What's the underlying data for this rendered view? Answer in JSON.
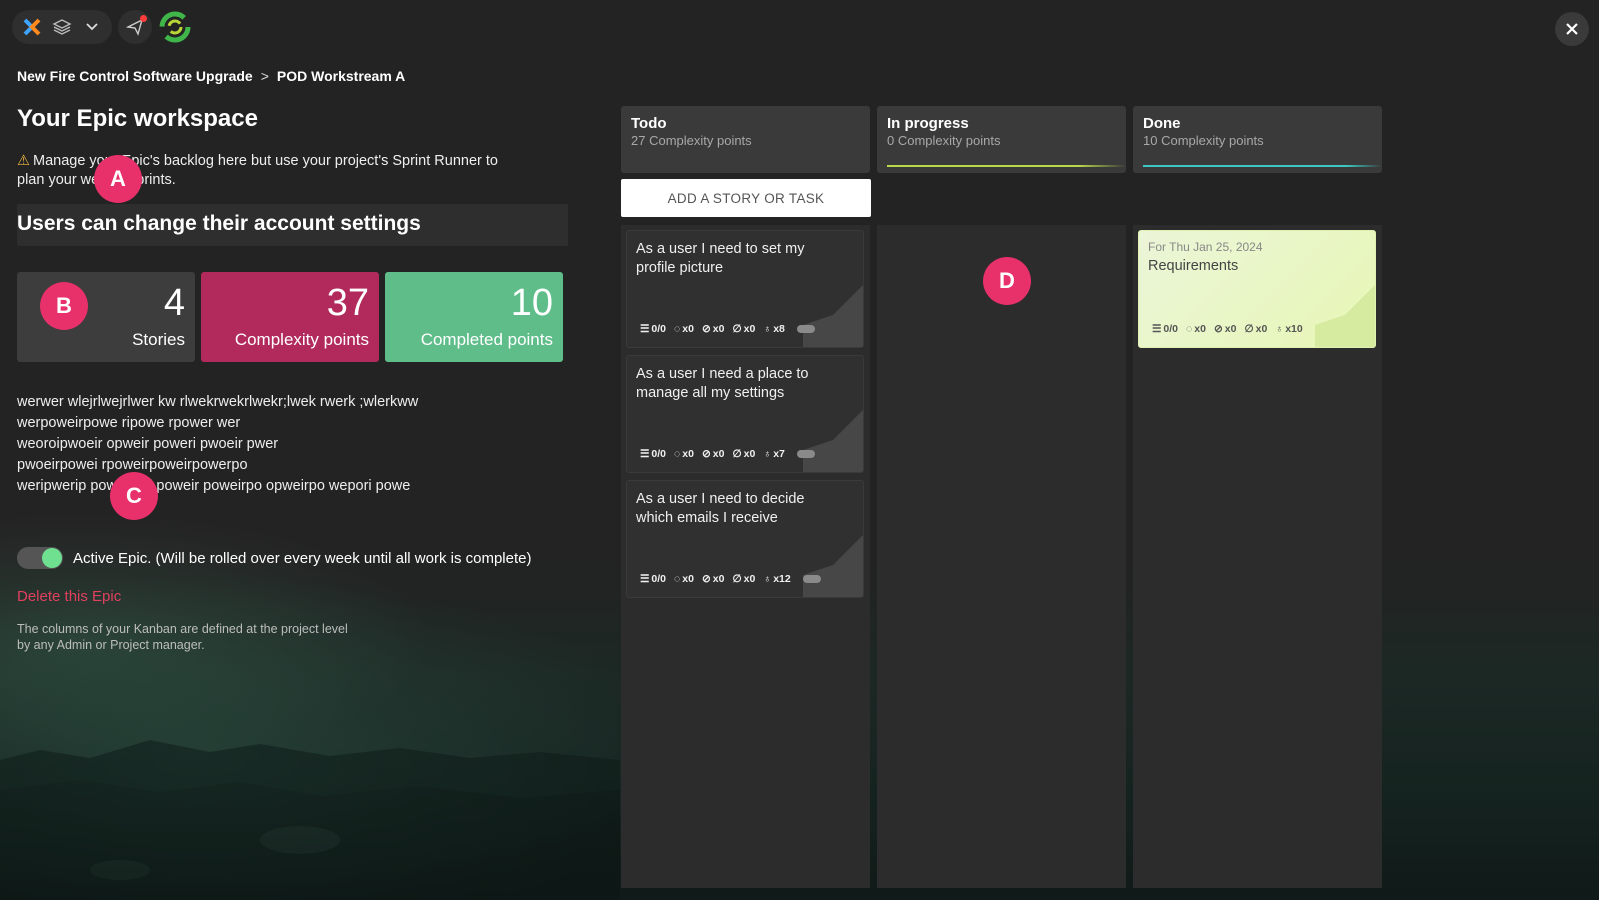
{
  "toolbar": {
    "icons": [
      "app-logo-icon",
      "layers-icon",
      "chevron-down-icon",
      "send-icon",
      "spinner-logo-icon"
    ],
    "close_icon": "close-icon"
  },
  "breadcrumb": {
    "project": "New Fire Control Software Upgrade",
    "separator": ">",
    "workstream": "POD Workstream A"
  },
  "workspace": {
    "title": "Your Epic workspace",
    "warning_icon": "⚠",
    "warning": "Manage your Epic's backlog here but use your project's Sprint Runner to plan your weekly sprints.",
    "epic_title": "Users can change their account settings"
  },
  "stats": {
    "stories": {
      "value": "4",
      "label": "Stories"
    },
    "complexity": {
      "value": "37",
      "label": "Complexity points"
    },
    "completed": {
      "value": "10",
      "label": "Completed points"
    }
  },
  "description": {
    "line1": "werwer wlejrlwejrlwer kw rlwekrwekrlwekr;lwek rwerk ;wlerkww",
    "line2": "werpoweirpowe ripowe rpower wer",
    "line3": "weoroipwoeir opweir poweri pwoeir pwer",
    "line4": "pwoeirpowei rpoweirpoweirpowerpo",
    "line5": "weripwerip poweripoi poweir poweirpo opweirpo wepori powe"
  },
  "toggle": {
    "label": "Active Epic. (Will be rolled over every week until all work is complete)",
    "on": true
  },
  "delete_link": "Delete this Epic",
  "footnote": {
    "line1": "The columns of your Kanban are defined at the project level",
    "line2": "by any Admin or Project manager."
  },
  "kanban": {
    "add_button": "ADD A STORY OR TASK",
    "columns": [
      {
        "name": "Todo",
        "points": "27 Complexity points",
        "bar_color": ""
      },
      {
        "name": "In progress",
        "points": "0 Complexity points",
        "bar_color": "#b8d94a"
      },
      {
        "name": "Done",
        "points": "10 Complexity points",
        "bar_color": "#3cc7c0"
      }
    ],
    "todo_cards": [
      {
        "title": "As a user I need to set my profile picture",
        "tasks": "0/0",
        "comments": "x0",
        "links": "x0",
        "attachments": "x0",
        "points": "x8"
      },
      {
        "title": "As a user I need a place to manage all my settings",
        "tasks": "0/0",
        "comments": "x0",
        "links": "x0",
        "attachments": "x0",
        "points": "x7"
      },
      {
        "title": "As a user I need to decide which emails I receive",
        "tasks": "0/0",
        "comments": "x0",
        "links": "x0",
        "attachments": "x0",
        "points": "x12"
      }
    ],
    "done_cards": [
      {
        "date": "For Thu Jan 25, 2024",
        "title": "Requirements",
        "tasks": "0/0",
        "comments": "x0",
        "links": "x0",
        "attachments": "x0",
        "points": "x10"
      }
    ]
  },
  "markers": {
    "a": "A",
    "b": "B",
    "c": "C",
    "d": "D"
  },
  "colors": {
    "complexity": "#b12a5b",
    "completed": "#5fbd8a",
    "delete": "#e0405e",
    "toggle_on": "#6fe08f",
    "marker": "#e8306b"
  }
}
